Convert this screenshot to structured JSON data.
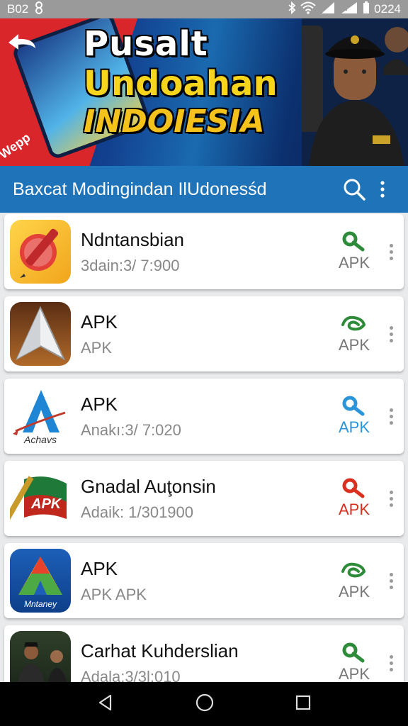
{
  "status": {
    "left_text": "B02",
    "time": "0224"
  },
  "banner": {
    "line1": "Pusalt",
    "line2": "Undoahan",
    "line3": "INDOIESIA",
    "corner_text": "Wepp"
  },
  "appbar": {
    "title": "Baxcat Modingindan IlUdonesśd",
    "search_icon": "search-icon",
    "menu_icon": "more-vert-icon"
  },
  "apps": [
    {
      "name": "Ndntansbian",
      "sub": "3dain:3/ 7:900",
      "apk": "APK",
      "icon": "pen-icon",
      "apk_color": "#2e8b3a",
      "key_icon": "key-icon"
    },
    {
      "name": "APK",
      "sub": "APK",
      "apk": "APK",
      "icon": "arrow-a-icon",
      "apk_color": "#2e8b3a",
      "key_icon": "swirl-icon"
    },
    {
      "name": "APK",
      "sub": "Anakı:3/ 7:020",
      "apk": "APK",
      "icon": "blue-a-icon",
      "icon_text": "Achavs",
      "apk_color": "#2b95d9",
      "key_icon": "key-icon"
    },
    {
      "name": "Gnadal Auţonsin",
      "sub": "Adaik: 1/301900",
      "apk": "APK",
      "icon": "flag-apk-icon",
      "icon_text": "APK",
      "apk_color": "#d9301f",
      "key_icon": "key-icon"
    },
    {
      "name": "APK",
      "sub": "APK  APK",
      "apk": "APK",
      "icon": "colorful-a-icon",
      "icon_text": "Mntaney",
      "apk_color": "#2e8b3a",
      "key_icon": "swirl-icon"
    },
    {
      "name": "Carhat Kuhderslian",
      "sub": "Adala:3/3l:010",
      "apk": "APK",
      "icon": "people-photo-icon",
      "apk_color": "#2e8b3a",
      "key_icon": "key-icon"
    }
  ],
  "colors": {
    "appbar": "#1f73b9",
    "statusbar": "#9a9a9a",
    "banner_red": "#d8262b",
    "banner_yellow": "#f6d51c"
  }
}
